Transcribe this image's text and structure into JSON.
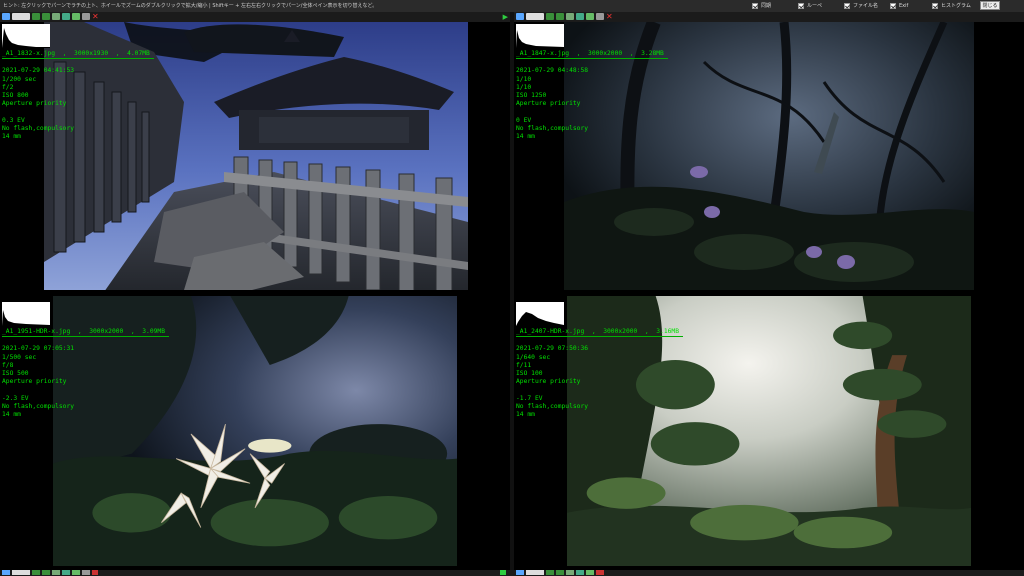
{
  "topbar": {
    "hint": "ヒント: 左クリックでパーンでラチの上ト、ホイールでズームのダブルクリックで拡大/縮小 | Shiftキー + 左右左右クリックでパーン/全体ペイン表示を切り替えなど。",
    "checkboxes": [
      {
        "label": "同期"
      },
      {
        "label": "ルーペ"
      },
      {
        "label": "ファイル名"
      },
      {
        "label": "Exif"
      },
      {
        "label": "ヒストグラム"
      }
    ],
    "close_label": "閉じる"
  },
  "panes": [
    {
      "file": "_A1_1832-x.jpg  ,  3000x1930  ,  4.07MB",
      "date": "2021-07-29 04:41:53",
      "shutter": "1/200 sec",
      "aperture": "f/2",
      "iso": "ISO 800",
      "mode": "Aperture priority",
      "ev": "0.3 EV",
      "flash": "No flash,compulsory",
      "focal": "14 mm",
      "scene": "Japanese shrine building with wooden fence on misty mountain at dusk"
    },
    {
      "file": "_A1_1847-x.jpg  ,  3000x2000  ,  3.28MB",
      "date": "2021-07-29 04:48:58",
      "shutter": "1/10",
      "aperture": "1/10",
      "iso": "ISO 1250",
      "mode": "Aperture priority",
      "ev": "0 EV",
      "flash": "No flash,compulsory",
      "focal": "14 mm",
      "scene": "Misty dark forest with purple hosta flowers"
    },
    {
      "file": "_A1_1951-HDR-x.jpg  ,  3000x2000  ,  3.09MB",
      "date": "2021-07-29 07:05:31",
      "shutter": "1/500 sec",
      "aperture": "f/8",
      "iso": "ISO 500",
      "mode": "Aperture priority",
      "ev": "-2.3 EV",
      "flash": "No flash,compulsory",
      "focal": "14 mm",
      "scene": "White lily flower in dark misty forest"
    },
    {
      "file": "_A1_2407-HDR-x.jpg  ,  3000x2000  ,  3.16MB",
      "date": "2021-07-29 07:50:36",
      "shutter": "1/640 sec",
      "aperture": "f/11",
      "iso": "ISO 100",
      "mode": "Aperture priority",
      "ev": "-1.7 EV",
      "flash": "No flash,compulsory",
      "focal": "14 mm",
      "scene": "Sunlit misty forest with tall cedar tree"
    }
  ]
}
